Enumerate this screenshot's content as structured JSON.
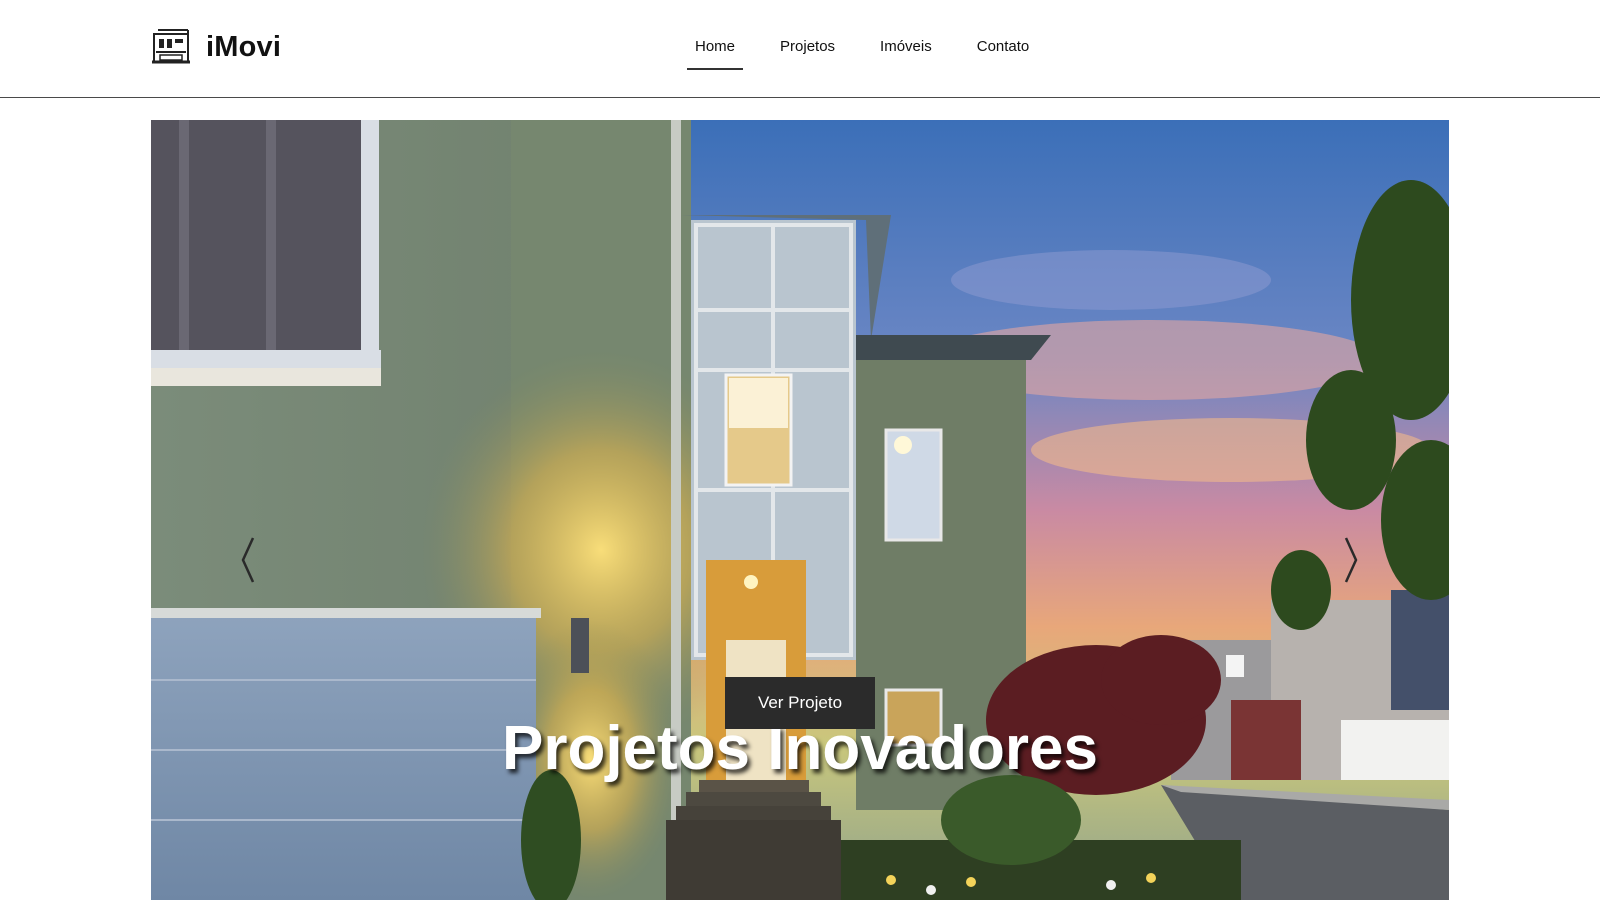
{
  "brand": {
    "name": "iMovi",
    "icon": "building-icon"
  },
  "nav": {
    "items": [
      {
        "label": "Home",
        "active": true
      },
      {
        "label": "Projetos",
        "active": false
      },
      {
        "label": "Imóveis",
        "active": false
      },
      {
        "label": "Contato",
        "active": false
      }
    ]
  },
  "hero": {
    "title": "Projetos Inovadores",
    "button_label": "Ver Projeto",
    "prev_icon": "chevron-left-icon",
    "next_icon": "chevron-right-icon"
  },
  "colors": {
    "button_bg": "#2b2b2b",
    "header_border": "#4a4a4a"
  }
}
